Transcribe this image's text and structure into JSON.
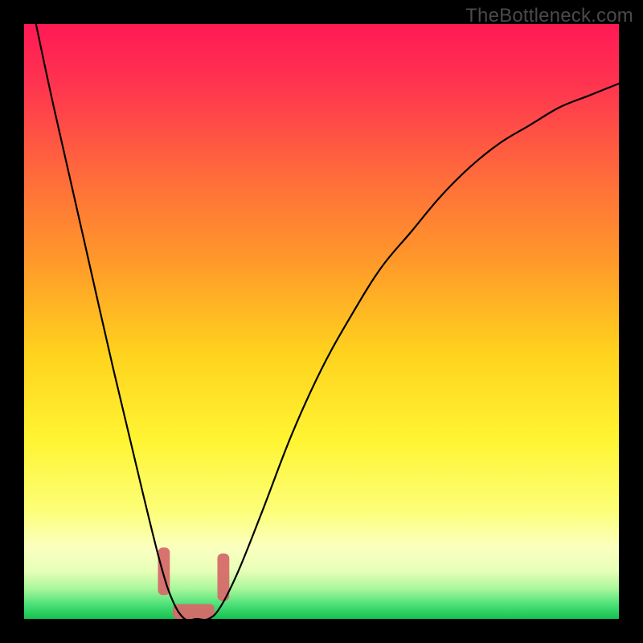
{
  "watermark": "TheBottleneck.com",
  "chart_data": {
    "type": "line",
    "title": "",
    "xlabel": "",
    "ylabel": "",
    "xlim": [
      0,
      100
    ],
    "ylim": [
      0,
      100
    ],
    "grid": false,
    "legend": false,
    "series": [
      {
        "name": "bottleneck-curve",
        "x": [
          2,
          5,
          10,
          15,
          20,
          23,
          25,
          27,
          29,
          31,
          33,
          36,
          40,
          45,
          50,
          55,
          60,
          65,
          70,
          75,
          80,
          85,
          90,
          95,
          100
        ],
        "y": [
          100,
          86,
          64,
          42,
          21,
          9,
          3,
          0,
          0,
          0,
          2,
          8,
          18,
          31,
          42,
          51,
          59,
          65,
          71,
          76,
          80,
          83,
          86,
          88,
          90
        ]
      }
    ],
    "markers": {
      "name": "highlight-segments",
      "color": "#d66a6a",
      "segments": [
        {
          "x_range": [
            22.5,
            24.5
          ],
          "y_range": [
            4,
            12
          ]
        },
        {
          "x_range": [
            25,
            32
          ],
          "y_range": [
            0,
            2.5
          ]
        },
        {
          "x_range": [
            32.5,
            34.5
          ],
          "y_range": [
            3,
            11
          ]
        }
      ]
    },
    "background_gradient": {
      "stops": [
        {
          "pos": 0.0,
          "color": "#ff1a55"
        },
        {
          "pos": 0.1,
          "color": "#ff3450"
        },
        {
          "pos": 0.25,
          "color": "#ff6a3c"
        },
        {
          "pos": 0.4,
          "color": "#ff9a2a"
        },
        {
          "pos": 0.55,
          "color": "#ffd21e"
        },
        {
          "pos": 0.7,
          "color": "#fff533"
        },
        {
          "pos": 0.82,
          "color": "#fdff7a"
        },
        {
          "pos": 0.88,
          "color": "#fbffc0"
        },
        {
          "pos": 0.92,
          "color": "#e7ffb8"
        },
        {
          "pos": 0.95,
          "color": "#a8f79a"
        },
        {
          "pos": 0.975,
          "color": "#4fe27a"
        },
        {
          "pos": 1.0,
          "color": "#14c24f"
        }
      ]
    }
  }
}
